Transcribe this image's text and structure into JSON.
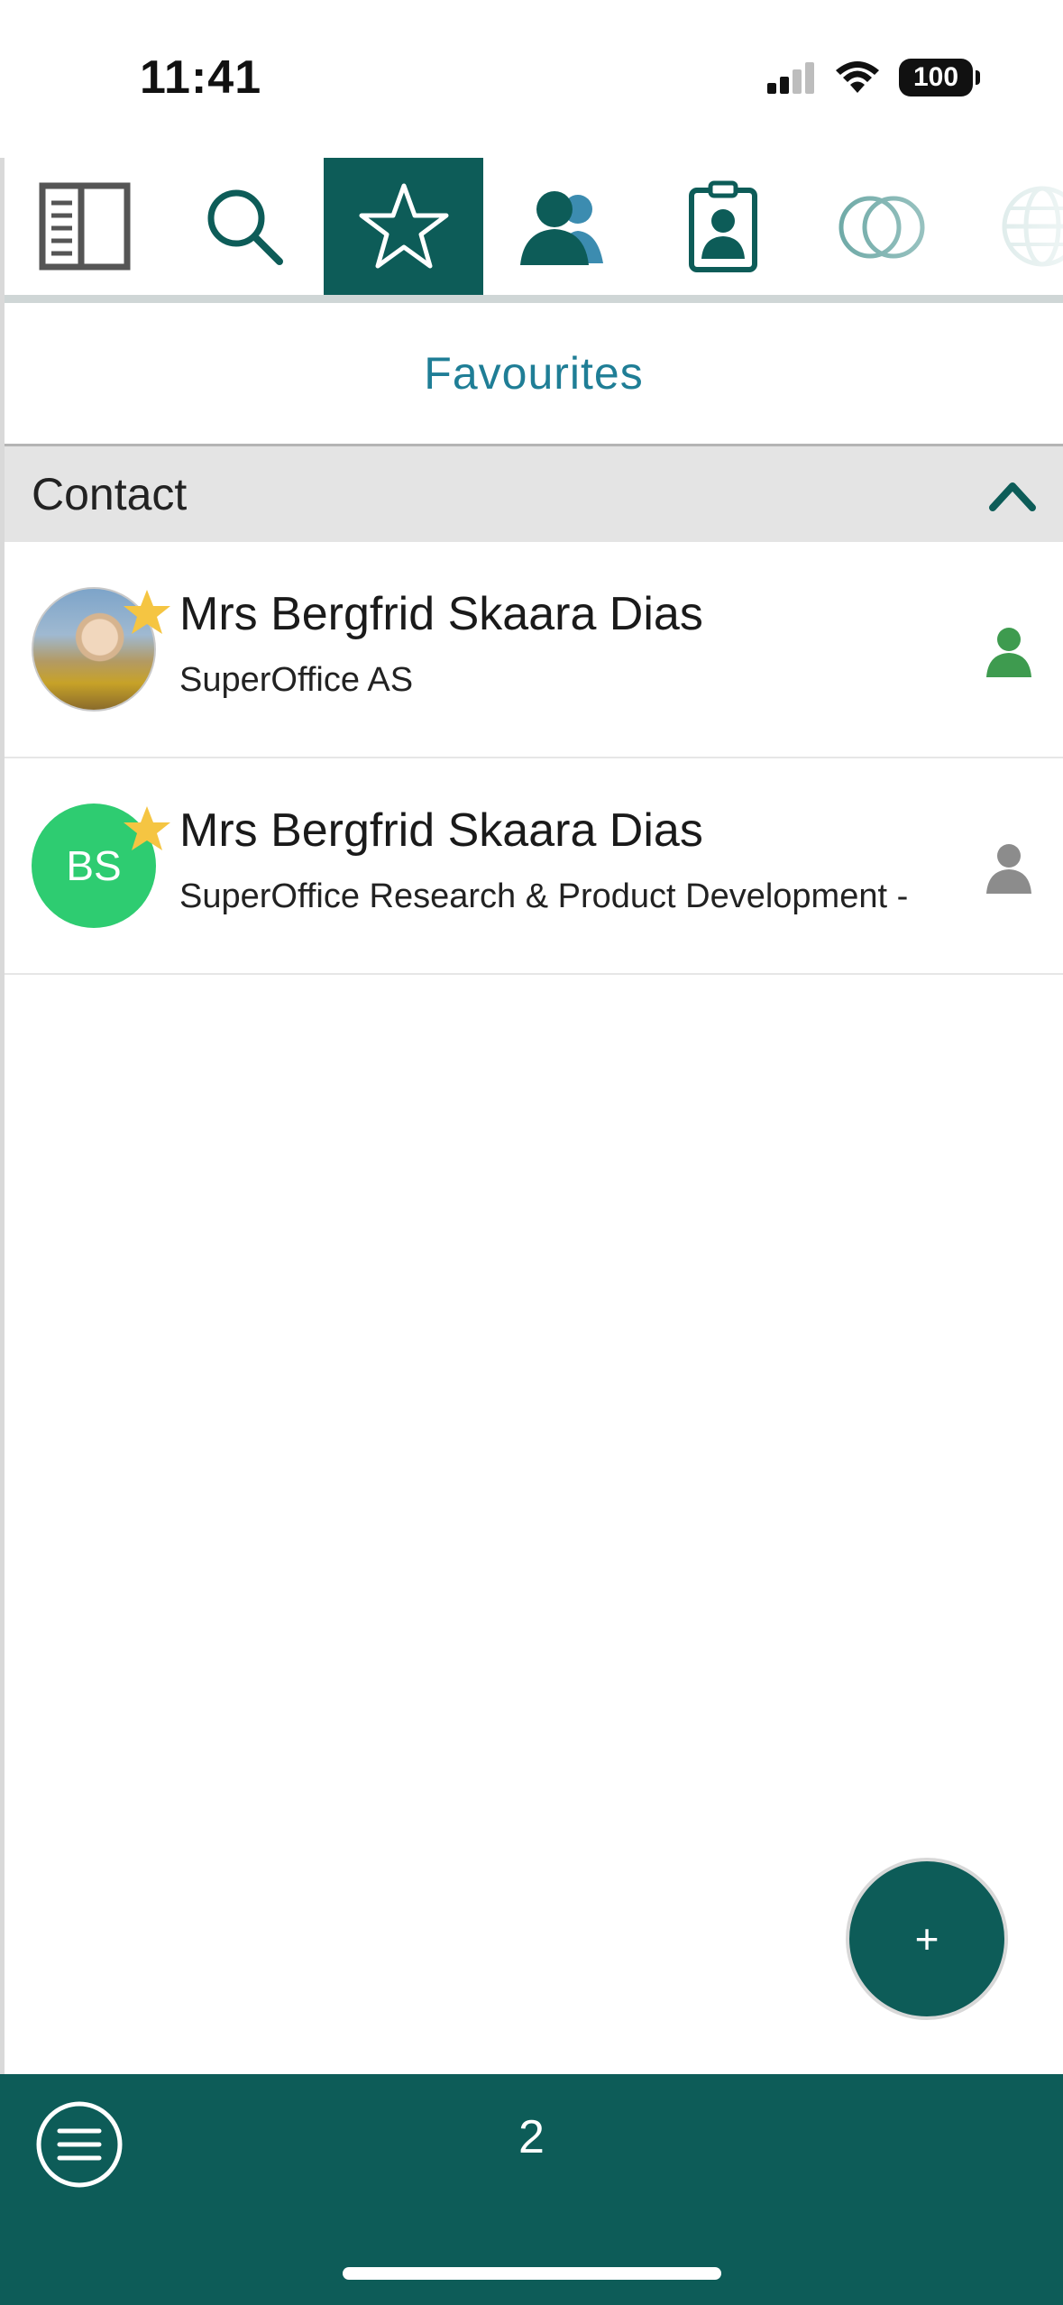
{
  "status_bar": {
    "time": "11:41",
    "battery": "100",
    "icons": [
      "cellular-signal-icon",
      "wifi-icon",
      "battery-icon"
    ]
  },
  "tabs": [
    {
      "name": "navigator",
      "icon": "panel-icon",
      "active": false
    },
    {
      "name": "find",
      "icon": "search-icon",
      "active": false
    },
    {
      "name": "favourites",
      "icon": "star-icon",
      "active": true
    },
    {
      "name": "contacts",
      "icon": "people-icon",
      "active": false
    },
    {
      "name": "person",
      "icon": "contact-card-icon",
      "active": false
    },
    {
      "name": "selections",
      "icon": "circles-icon",
      "active": false
    },
    {
      "name": "web",
      "icon": "globe-icon",
      "active": false
    }
  ],
  "page": {
    "title": "Favourites"
  },
  "section": {
    "label": "Contact",
    "expanded": true
  },
  "rows": [
    {
      "name": "Mrs Bergfrid Skaara Dias",
      "company": "SuperOffice AS",
      "avatar_type": "photo",
      "favourite": true,
      "person_icon_color": "#3e9b4f"
    },
    {
      "name": "Mrs Bergfrid Skaara Dias",
      "company": "SuperOffice Research & Product Development  -",
      "avatar_type": "initials",
      "initials": "BS",
      "favourite": true,
      "person_icon_color": "#8c8c8c"
    }
  ],
  "fab": {
    "label": "+"
  },
  "bottom_bar": {
    "count": "2"
  },
  "colors": {
    "primary": "#0d5c58",
    "title": "#1f7e96",
    "initials_bg": "#2ecc71",
    "star": "#f5c542"
  }
}
